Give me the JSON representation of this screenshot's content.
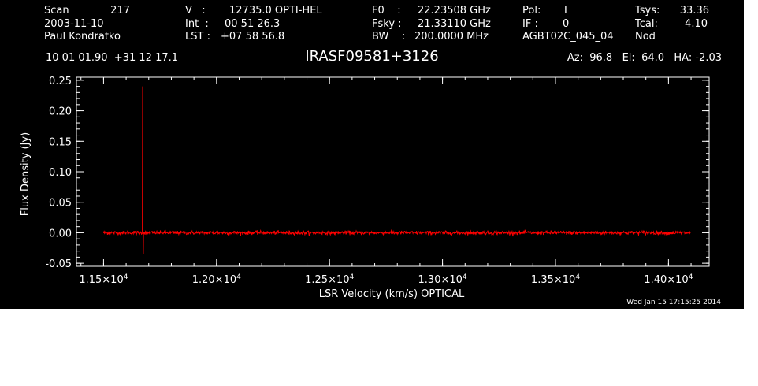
{
  "header": {
    "col1": {
      "scan_label": "Scan",
      "scan_value": "217",
      "date": "2003-11-10",
      "observer": "Paul Kondratko"
    },
    "col2": {
      "v_label": "V   :",
      "v_value": "12735.0 OPTI-HEL",
      "int_label": "Int  :",
      "int_value": "00 51 26.3",
      "lst_label": "LST :",
      "lst_value": "+07 58 56.8"
    },
    "col3": {
      "f0_label": "F0    :",
      "f0_value": "22.23508 GHz",
      "fsky_label": "Fsky :",
      "fsky_value": "21.33110 GHz",
      "bw_label": "BW    :",
      "bw_value": "200.0000 MHz"
    },
    "col4": {
      "pol_label": "Pol:",
      "pol_value": "I",
      "if_label": "IF :",
      "if_value": "0",
      "project": "AGBT02C_045_04"
    },
    "col5": {
      "tsys_label": "Tsys:",
      "tsys_value": "33.36",
      "tcal_label": "Tcal:",
      "tcal_value": "4.10",
      "mode": "Nod"
    },
    "coords": "10 01 01.90  +31 12 17.1",
    "source": "IRASF09581+3126",
    "az_el_ha": "Az:  96.8   El:  64.0   HA: -2.03"
  },
  "footer": {
    "timestamp": "Wed Jan 15 17:15:25 2014"
  },
  "colors": {
    "background": "#000000",
    "axes": "#ffffff",
    "spectrum": "#ff0000"
  },
  "chart_data": {
    "type": "line",
    "title": "IRASF09581+3126",
    "xlabel": "LSR Velocity (km/s) OPTICAL",
    "ylabel": "Flux Density (Jy)",
    "xlim": [
      11380,
      14180
    ],
    "ylim": [
      -0.055,
      0.255
    ],
    "x_ticks": [
      11500,
      12000,
      12500,
      13000,
      13500,
      14000
    ],
    "x_tick_labels": [
      {
        "mant": "1.15",
        "exp": "4"
      },
      {
        "mant": "1.20",
        "exp": "4"
      },
      {
        "mant": "1.25",
        "exp": "4"
      },
      {
        "mant": "1.30",
        "exp": "4"
      },
      {
        "mant": "1.35",
        "exp": "4"
      },
      {
        "mant": "1.40",
        "exp": "4"
      }
    ],
    "y_ticks": [
      -0.05,
      0.0,
      0.05,
      0.1,
      0.15,
      0.2,
      0.25
    ],
    "y_tick_labels": [
      "-0.05",
      "0.00",
      "0.05",
      "0.10",
      "0.15",
      "0.20",
      "0.25"
    ],
    "x_minor_step": 100,
    "y_minor_step": 0.01,
    "grid": false,
    "series": [
      {
        "color": "#ff0000",
        "x_range": [
          11500,
          14100
        ],
        "baseline": 0.0,
        "noise_rms": 0.0015,
        "features": [
          {
            "x": 11673,
            "y": 0.24
          },
          {
            "x": 11676,
            "y": -0.035
          }
        ]
      }
    ]
  }
}
